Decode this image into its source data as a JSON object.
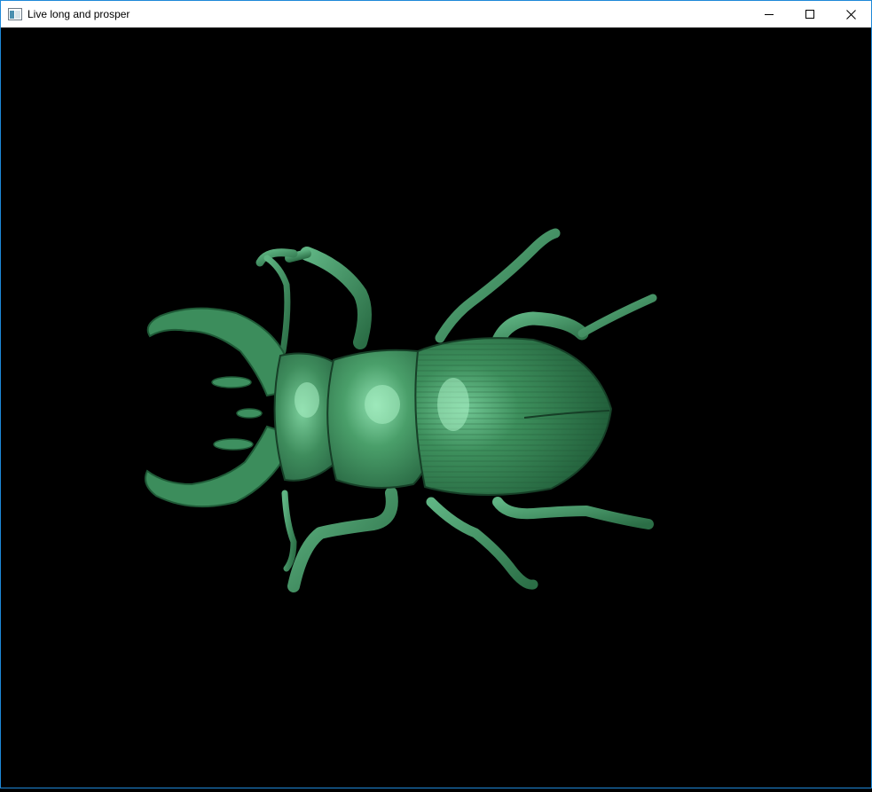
{
  "window": {
    "title": "Live long and prosper",
    "controls": [
      "minimize",
      "maximize",
      "close"
    ]
  },
  "viewport": {
    "background": "#000000",
    "model_color": "#2f7a4c",
    "model_highlight": "#7fd3a0",
    "subject": "stag beetle"
  },
  "colors": {
    "border": "#1e88d8",
    "titlebar": "#ffffff"
  }
}
